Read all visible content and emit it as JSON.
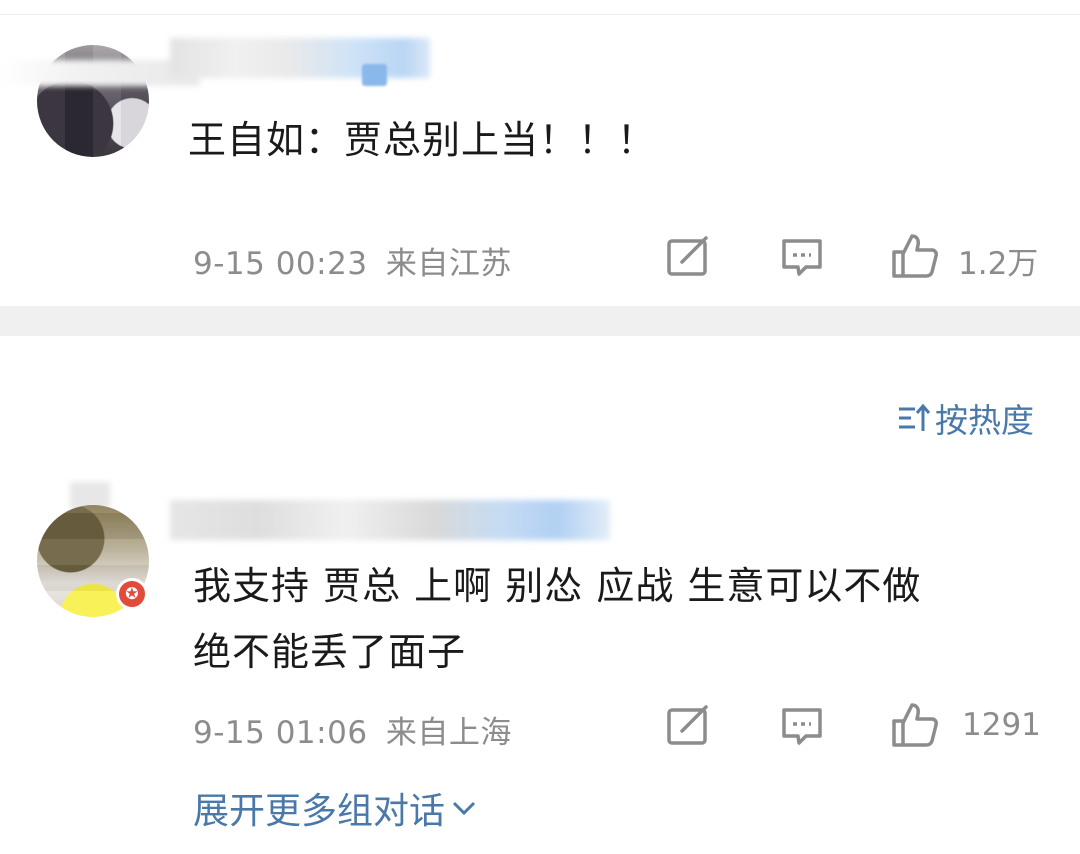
{
  "comments": [
    {
      "text": "王自如：贾总别上当！！！",
      "date": "9-15 00:23",
      "location": "来自江苏",
      "likes": "1.2万"
    },
    {
      "text_line1": "我支持 贾总 上啊 别怂 应战 生意可以不做",
      "text_line2": "绝不能丢了面子",
      "date": "9-15 01:06",
      "location": "来自上海",
      "likes": "1291"
    }
  ],
  "sort": {
    "label": "按热度",
    "icon": "sort-icon"
  },
  "expand": {
    "label": "展开更多组对话",
    "icon": "chevron-down-icon"
  },
  "icons": [
    "repost-icon",
    "comment-icon",
    "like-icon"
  ],
  "colors": {
    "link": "#4a78a8",
    "meta": "#8c8c8c",
    "badge": "#e24a3b"
  }
}
